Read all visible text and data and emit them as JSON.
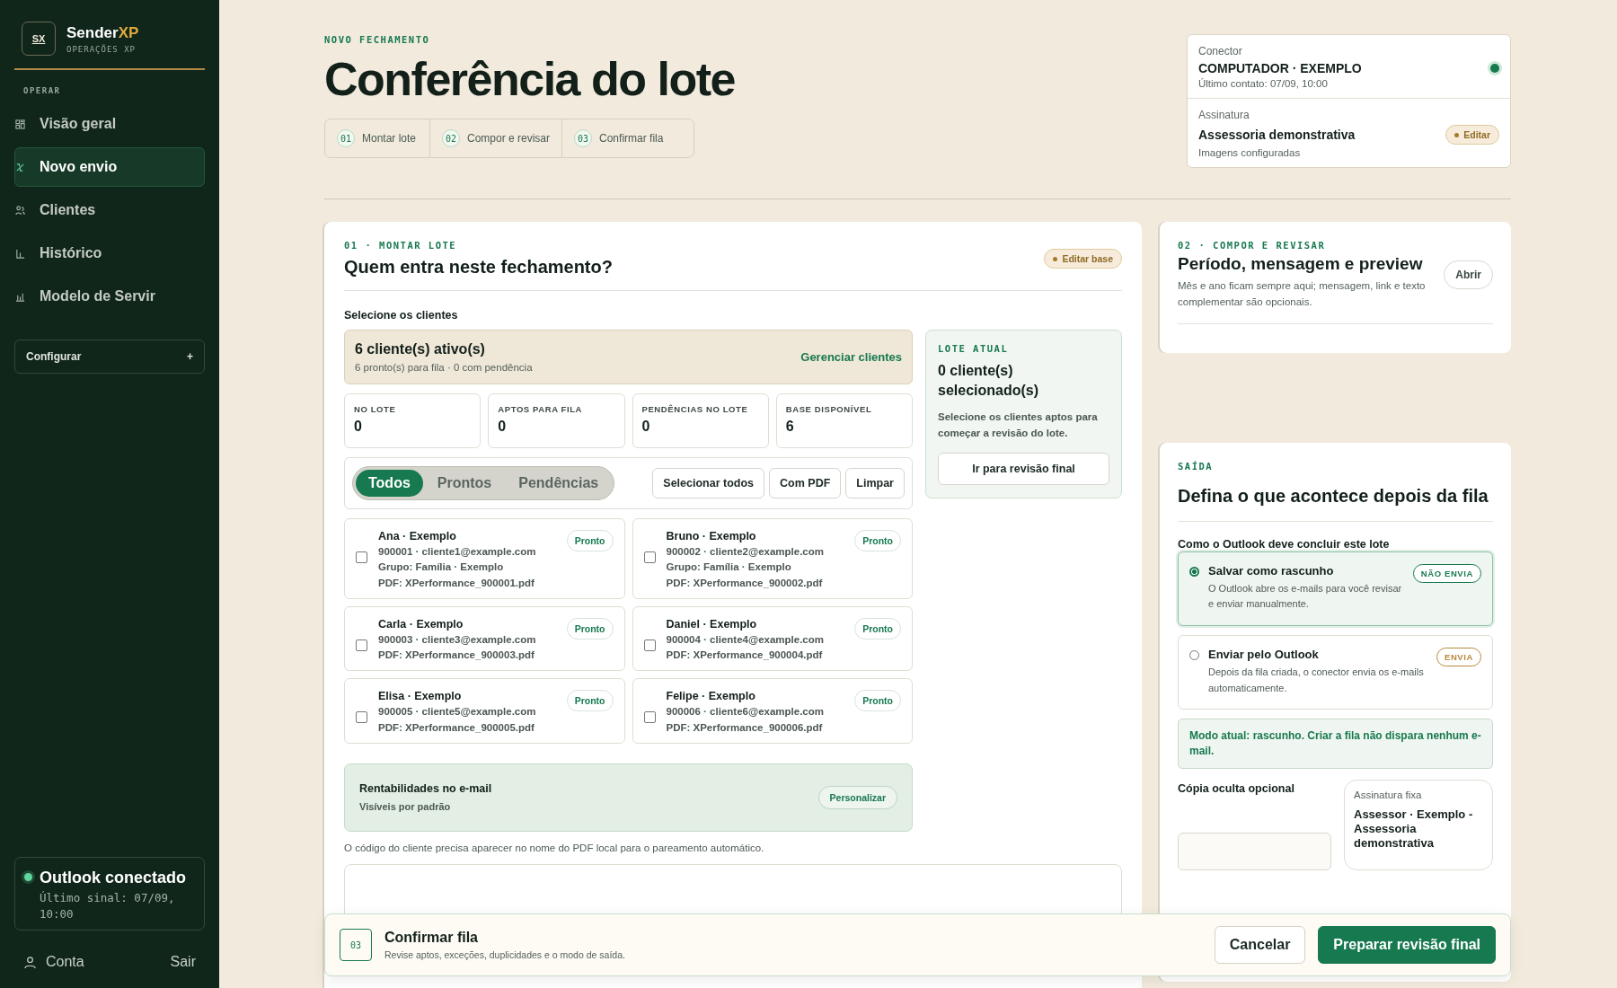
{
  "sidebar": {
    "brand": {
      "logo": "SX",
      "name": "Sender",
      "name_accent": "XP",
      "subtitle": "OPERAÇÕES XP"
    },
    "section_label": "OPERAR",
    "items": [
      {
        "label": "Visão geral",
        "selected": false
      },
      {
        "label": "Novo envio",
        "selected": true
      },
      {
        "label": "Clientes",
        "selected": false
      },
      {
        "label": "Histórico",
        "selected": false
      },
      {
        "label": "Modelo de Servir",
        "selected": false
      }
    ],
    "configure": {
      "label": "Configurar",
      "symbol": "+"
    },
    "status": {
      "title": "Outlook conectado",
      "detail": "Último sinal: 07/09, 10:00",
      "connected": true
    },
    "account": "Conta",
    "logout": "Sair"
  },
  "header": {
    "eyebrow": "NOVO FECHAMENTO",
    "title": "Conferência do lote",
    "steps": [
      {
        "number": "01",
        "label": "Montar lote"
      },
      {
        "number": "02",
        "label": "Compor e revisar"
      },
      {
        "number": "03",
        "label": "Confirmar fila"
      }
    ]
  },
  "connector": {
    "label": "Conector",
    "name": "COMPUTADOR · EXEMPLO",
    "detail": "Último contato: 07/09, 10:00",
    "online": true
  },
  "signature": {
    "label": "Assinatura",
    "name": "Assessoria demonstrativa",
    "detail": "Imagens configuradas",
    "button": "Editar"
  },
  "batch": {
    "eyebrow": "01 · MONTAR LOTE",
    "title": "Quem entra neste fechamento?",
    "edit_button": "Editar base",
    "section_label": "Selecione os clientes",
    "summary": {
      "title": "6 cliente(s) ativo(s)",
      "detail": "6 pronto(s) para fila · 0 com pendência",
      "link": "Gerenciar clientes"
    },
    "stats": [
      {
        "label": "NO LOTE",
        "value": "0"
      },
      {
        "label": "APTOS PARA FILA",
        "value": "0"
      },
      {
        "label": "PENDÊNCIAS NO LOTE",
        "value": "0"
      },
      {
        "label": "BASE DISPONÍVEL",
        "value": "6"
      }
    ],
    "filters": [
      {
        "label": "Todos",
        "selected": true
      },
      {
        "label": "Prontos",
        "selected": false
      },
      {
        "label": "Pendências",
        "selected": false
      }
    ],
    "actions": [
      "Selecionar todos",
      "Com PDF",
      "Limpar"
    ],
    "clients": [
      {
        "name": "Ana · Exemplo",
        "contact": "900001 · cliente1@example.com",
        "group": "Grupo: Família · Exemplo",
        "pdf": "PDF: XPerformance_900001.pdf",
        "status": "Pronto",
        "checked": false
      },
      {
        "name": "Bruno · Exemplo",
        "contact": "900002 · cliente2@example.com",
        "group": "Grupo: Família · Exemplo",
        "pdf": "PDF: XPerformance_900002.pdf",
        "status": "Pronto",
        "checked": false
      },
      {
        "name": "Carla · Exemplo",
        "contact": "900003 · cliente3@example.com",
        "pdf": "PDF: XPerformance_900003.pdf",
        "status": "Pronto",
        "checked": false
      },
      {
        "name": "Daniel · Exemplo",
        "contact": "900004 · cliente4@example.com",
        "pdf": "PDF: XPerformance_900004.pdf",
        "status": "Pronto",
        "checked": false
      },
      {
        "name": "Elisa · Exemplo",
        "contact": "900005 · cliente5@example.com",
        "pdf": "PDF: XPerformance_900005.pdf",
        "status": "Pronto",
        "checked": false
      },
      {
        "name": "Felipe · Exemplo",
        "contact": "900006 · cliente6@example.com",
        "pdf": "PDF: XPerformance_900006.pdf",
        "status": "Pronto",
        "checked": false
      }
    ],
    "returns": {
      "title": "Rentabilidades no e-mail",
      "detail": "Visíveis por padrão",
      "button": "Personalizar"
    },
    "note": "O código do cliente precisa aparecer no nome do PDF local para o pareamento automático."
  },
  "current_batch": {
    "eyebrow": "LOTE ATUAL",
    "title": "0 cliente(s) selecionado(s)",
    "detail": "Selecione os clientes aptos para começar a revisão do lote.",
    "button": "Ir para revisão final"
  },
  "compose": {
    "eyebrow": "02 · COMPOR E REVISAR",
    "title": "Período, mensagem e preview",
    "detail": "Mês e ano ficam sempre aqui; mensagem, link e texto complementar são opcionais.",
    "button": "Abrir"
  },
  "output": {
    "eyebrow": "SAÍDA",
    "title": "Defina o que acontece depois da fila",
    "question": "Como o Outlook deve concluir este lote",
    "options": [
      {
        "title": "Salvar como rascunho",
        "detail": "O Outlook abre os e-mails para você revisar e enviar manualmente.",
        "badge": "NÃO ENVIA",
        "color": "#17794f",
        "selected": true
      },
      {
        "title": "Enviar pelo Outlook",
        "detail": "Depois da fila criada, o conector envia os e-mails automaticamente.",
        "badge": "ENVIA",
        "color": "#b7893c",
        "selected": false
      }
    ],
    "mode_note": "Modo atual: rascunho. Criar a fila não dispara nenhum e-mail.",
    "bcc_label": "Cópia oculta opcional",
    "fixed_signature": {
      "label": "Assinatura fixa",
      "text": "Assessor · Exemplo - Assessoria demonstrativa"
    }
  },
  "confirm_bar": {
    "number": "03",
    "title": "Confirmar fila",
    "detail": "Revise aptos, exceções, duplicidades e o modo de saída.",
    "buttons": [
      {
        "label": "Cancelar",
        "kind": "secondary"
      },
      {
        "label": "Preparar revisão final",
        "kind": "primary"
      }
    ]
  }
}
